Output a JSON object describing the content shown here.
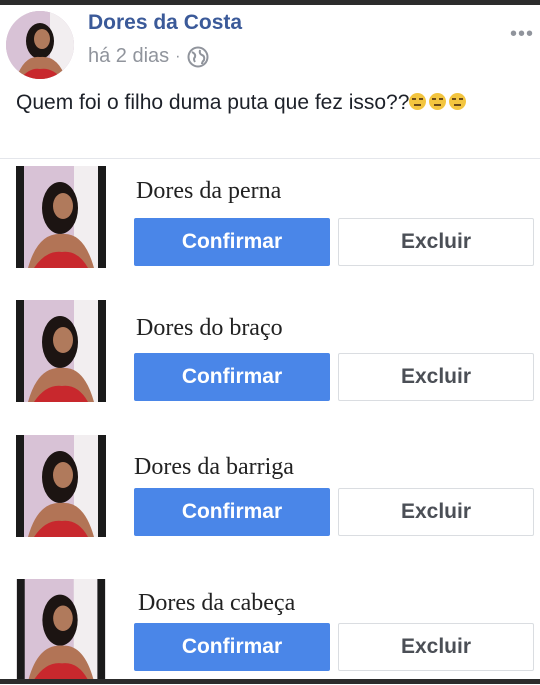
{
  "post": {
    "author": "Dores da Costa",
    "time": "há 2 dias",
    "separator": "·",
    "privacy_icon": "globe-icon",
    "more_icon": "more-options-icon",
    "more_glyph": "•••",
    "caption": "Quem foi o filho duma puta que fez isso??",
    "caption_emojis": [
      "unamused-face-emoji",
      "unamused-face-emoji",
      "unamused-face-emoji"
    ]
  },
  "requests": [
    {
      "name": "Dores da perna",
      "confirm_label": "Confirmar",
      "delete_label": "Excluir"
    },
    {
      "name": "Dores do braço",
      "confirm_label": "Confirmar",
      "delete_label": "Excluir"
    },
    {
      "name": "Dores da barriga",
      "confirm_label": "Confirmar",
      "delete_label": "Excluir"
    },
    {
      "name": "Dores da cabeça",
      "confirm_label": "Confirmar",
      "delete_label": "Excluir"
    }
  ],
  "colors": {
    "author_link": "#3b5a99",
    "confirm_button": "#4a86e8",
    "muted_text": "#90949c"
  }
}
